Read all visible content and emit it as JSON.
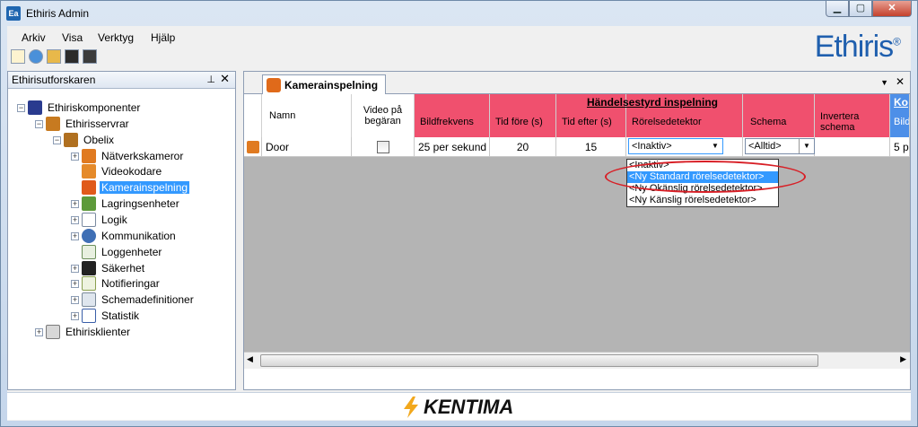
{
  "window": {
    "title": "Ethiris Admin",
    "app_icon_text": "Ea"
  },
  "menu": [
    "Arkiv",
    "Visa",
    "Verktyg",
    "Hjälp"
  ],
  "brand": {
    "name": "Ethiris",
    "mark": "®"
  },
  "explorer": {
    "title": "Ethirisutforskaren",
    "pin_glyph": "📌",
    "close_glyph": "✕",
    "nodes": [
      {
        "label": "Ethiriskomponenter",
        "icon": "ethiris-components-icon",
        "color": "#2a3b8f"
      },
      {
        "label": "Ethirisservrar",
        "icon": "server-group-icon",
        "color": "#c77a20"
      },
      {
        "label": "Obelix",
        "icon": "server-icon",
        "color": "#b07020"
      },
      {
        "label": "Nätverkskameror",
        "icon": "network-camera-icon",
        "color": "#e07a20"
      },
      {
        "label": "Videokodare",
        "icon": "video-encoder-icon",
        "color": "#e58a2a"
      },
      {
        "label": "Kamerainspelning",
        "icon": "camera-recording-icon",
        "color": "#e05a1a"
      },
      {
        "label": "Lagringsenheter",
        "icon": "storage-icon",
        "color": "#5d9a3a"
      },
      {
        "label": "Logik",
        "icon": "logic-icon",
        "color": "#7a8aa0"
      },
      {
        "label": "Kommunikation",
        "icon": "communication-icon",
        "color": "#3f6fb5"
      },
      {
        "label": "Loggenheter",
        "icon": "log-icon",
        "color": "#6b8f5a"
      },
      {
        "label": "Säkerhet",
        "icon": "security-icon",
        "color": "#222222"
      },
      {
        "label": "Notifieringar",
        "icon": "notification-icon",
        "color": "#8aa050"
      },
      {
        "label": "Schemadefinitioner",
        "icon": "schedule-icon",
        "color": "#7a8a9a"
      },
      {
        "label": "Statistik",
        "icon": "statistics-icon",
        "color": "#3a5ea8"
      },
      {
        "label": "Ethirisklienter",
        "icon": "client-icon",
        "color": "#7a7a7a"
      }
    ]
  },
  "document": {
    "tab_label": "Kamerainspelning",
    "close_glyph": "✕",
    "menu_glyph": "▼",
    "group_header": "Händelsestyrd inspelning",
    "group_header_2": "Ko",
    "columns": {
      "name": "Namn",
      "video_on_demand": "Video på begäran",
      "framerate": "Bildfrekvens",
      "time_before": "Tid före (s)",
      "time_after": "Tid efter (s)",
      "motion_detector": "Rörelsedetektor",
      "schedule": "Schema",
      "invert_schedule": "Invertera schema",
      "framerate_2": "Bild"
    },
    "row": {
      "name": "Door",
      "framerate": "25 per sekund",
      "time_before": "20",
      "time_after": "15",
      "motion_detector": "<Inaktiv>",
      "schedule": "<Alltid>",
      "framerate_2": "5 p"
    },
    "dropdown_options": [
      "<Inaktiv>",
      "<Ny Standard rörelsedetektor>",
      "<Ny Okänslig rörelsedetektor>",
      "<Ny Känslig rörelsedetektor>"
    ],
    "dropdown_selected_index": 1
  },
  "footer": {
    "brand": "KENTIMA"
  },
  "colors": {
    "group_header_bg": "#f0506e",
    "selection": "#3399ff",
    "accent_blue": "#1f5fae",
    "ring": "#d81f26"
  }
}
